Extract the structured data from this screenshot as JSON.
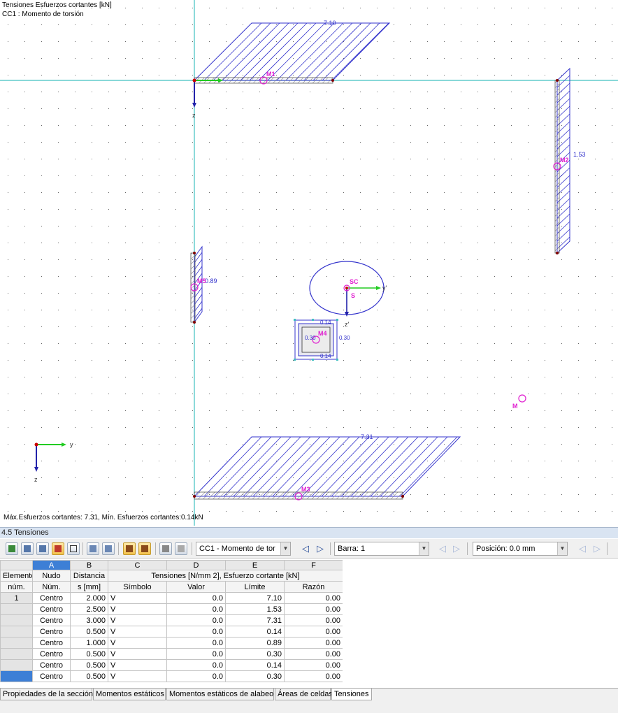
{
  "canvas": {
    "title_line1": "Tensiones Esfuerzos cortantes [kN]",
    "title_line2": "CC1 : Momento de torsión",
    "footer": "Máx.Esfuerzos cortantes: 7.31, Mín. Esfuerzos cortantes:0.14kN",
    "labels": {
      "top_value": "7.10",
      "right_value": "1.53",
      "left_value": "0.89",
      "bottom_value": "7.31",
      "box_top": "0.14",
      "box_left": "0.30",
      "box_right": "0.30",
      "box_bottom": "0.14",
      "node_m1": "M1",
      "node_m2": "M2",
      "node_m3": "M3",
      "node_m4": "M4",
      "node_m5": "M5",
      "node_sc": "SC",
      "node_s": "S",
      "node_m": "M",
      "axis_z_main": "z",
      "axis_z_sc": "z'",
      "axis_y_sc": "y'",
      "axis_y_corner": "y",
      "axis_z_corner": "z"
    }
  },
  "panel": {
    "title": "4.5 Tensiones"
  },
  "toolbar": {
    "loadcase": "CC1 - Momento de tor",
    "bar_label": "Barra: 1",
    "position_label": "Posición: 0.0 mm",
    "prev": "◁",
    "next": "▷"
  },
  "table": {
    "col_letters": [
      "A",
      "B",
      "C",
      "D",
      "E",
      "F"
    ],
    "group_header": "Tensiones [N/mm 2], Esfuerzo cortante [kN]",
    "h1": {
      "elem": "Elemento",
      "node": "Nudo",
      "dist": "Distancia"
    },
    "h2": {
      "elem": "núm.",
      "node": "Núm.",
      "dist": "s [mm]",
      "sym": "Símbolo",
      "val": "Valor",
      "lim": "Límite",
      "ratio": "Razón"
    },
    "rows": [
      {
        "elem": "1",
        "node": "Centro",
        "dist": "2.000",
        "sym": "V",
        "val": "0.0",
        "lim": "7.10",
        "ratio": "0.00"
      },
      {
        "elem": "",
        "node": "Centro",
        "dist": "2.500",
        "sym": "V",
        "val": "0.0",
        "lim": "1.53",
        "ratio": "0.00"
      },
      {
        "elem": "",
        "node": "Centro",
        "dist": "3.000",
        "sym": "V",
        "val": "0.0",
        "lim": "7.31",
        "ratio": "0.00"
      },
      {
        "elem": "",
        "node": "Centro",
        "dist": "0.500",
        "sym": "V",
        "val": "0.0",
        "lim": "0.14",
        "ratio": "0.00"
      },
      {
        "elem": "",
        "node": "Centro",
        "dist": "1.000",
        "sym": "V",
        "val": "0.0",
        "lim": "0.89",
        "ratio": "0.00"
      },
      {
        "elem": "",
        "node": "Centro",
        "dist": "0.500",
        "sym": "V",
        "val": "0.0",
        "lim": "0.30",
        "ratio": "0.00"
      },
      {
        "elem": "",
        "node": "Centro",
        "dist": "0.500",
        "sym": "V",
        "val": "0.0",
        "lim": "0.14",
        "ratio": "0.00"
      },
      {
        "elem": "",
        "node": "Centro",
        "dist": "0.500",
        "sym": "V",
        "val": "0.0",
        "lim": "0.30",
        "ratio": "0.00"
      }
    ]
  },
  "tabs": [
    "Propiedades de la sección",
    "Momentos estáticos",
    "Momentos estáticos de alabeo",
    "Áreas de celdas",
    "Tensiones"
  ],
  "active_tab": "Tensiones",
  "colors": {
    "diagram": "#3333cc",
    "node": "#e020d0",
    "axis_line": "#40c0c0",
    "y_axis": "#22cc22",
    "z_axis": "#2222aa",
    "selection": "#3d7fd6"
  }
}
